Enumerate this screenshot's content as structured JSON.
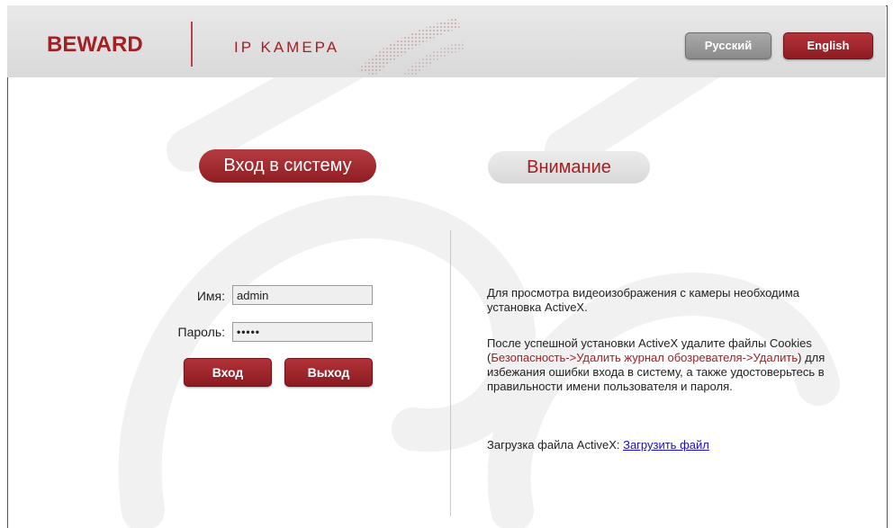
{
  "header": {
    "logo": "BEWARD",
    "product": "IP KAMEPA"
  },
  "language": {
    "russian": "Русский",
    "english": "English"
  },
  "tabs": {
    "login": "Вход в систему",
    "notice": "Внимание"
  },
  "form": {
    "username_label": "Имя:",
    "username_value": "admin",
    "password_label": "Пароль:",
    "password_value": "•••••",
    "login_button": "Вход",
    "exit_button": "Выход"
  },
  "info": {
    "para1": "Для просмотра видеоизображения с камеры необходима установка ActiveX.",
    "para2_start": "После успешной установки ActiveX удалите файлы Cookies (",
    "para2_path": "Безопасность->Удалить журнал обозревателя->Удалить",
    "para2_end": ") для избежания ошибки входа в систему, а также удостоверьтесь в правильности имени пользователя и пароля.",
    "download_label": "Загрузка файла ActiveX: ",
    "download_link": "Загрузить файл"
  },
  "colors": {
    "brand_red": "#a21f24",
    "button_gray": "#8a8a8a",
    "header_bg": "#dcdcdc",
    "link": "#1a0dcc"
  }
}
